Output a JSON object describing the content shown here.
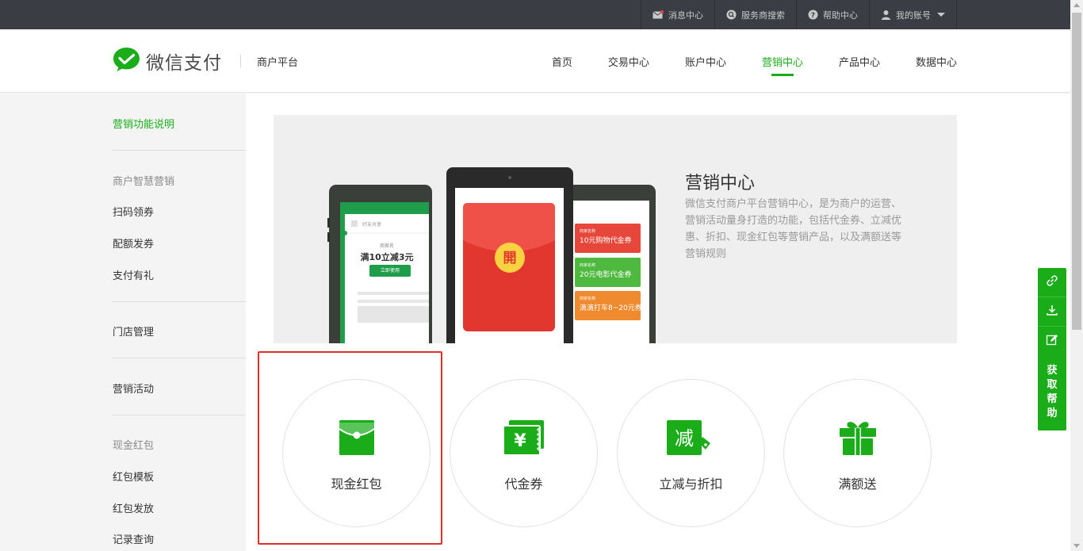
{
  "topbar": {
    "items": [
      {
        "label": "消息中心",
        "icon": "mail-icon"
      },
      {
        "label": "服务商搜索",
        "icon": "search-icon"
      },
      {
        "label": "帮助中心",
        "icon": "question-icon"
      },
      {
        "label": "我的账号",
        "icon": "user-icon"
      }
    ]
  },
  "header": {
    "logo_text": "微信支付",
    "subtitle": "商户平台",
    "nav": [
      {
        "label": "首页"
      },
      {
        "label": "交易中心"
      },
      {
        "label": "账户中心"
      },
      {
        "label": "营销中心",
        "active": true
      },
      {
        "label": "产品中心"
      },
      {
        "label": "数据中心"
      }
    ]
  },
  "sidebar": {
    "intro": "营销功能说明",
    "group_smart": "商户智慧营销",
    "smart_items": [
      "扫码领券",
      "配额发券",
      "支付有礼"
    ],
    "store": "门店管理",
    "activity": "营销活动",
    "group_cash": "现金红包",
    "cash_items": [
      "红包模板",
      "红包发放",
      "记录查询"
    ]
  },
  "banner": {
    "title": "营销中心",
    "description": "微信支付商户平台营销中心，是为商户的运营、营销活动量身打造的功能，包括代金券、立减优惠、折扣、现金红包等营销产品，以及满额送等营销规则",
    "phone_left": {
      "top": "好友共享",
      "merchant": "商家名",
      "offer": "满10立减3元",
      "button": "立即使用"
    },
    "phone_center": {
      "open": "開"
    },
    "phone_right": {
      "coupons": [
        {
          "tag": "商家名称",
          "text": "10元购物代金券"
        },
        {
          "tag": "商家名称",
          "text": "20元电影代金券"
        },
        {
          "tag": "商家名称",
          "text": "滴滴打车8~20元券"
        }
      ]
    }
  },
  "cards": [
    {
      "label": "现金红包",
      "icon": "red-packet-icon"
    },
    {
      "label": "代金券",
      "icon": "voucher-icon"
    },
    {
      "label": "立减与折扣",
      "icon": "discount-icon"
    },
    {
      "label": "满额送",
      "icon": "gift-icon"
    }
  ],
  "float_widget": {
    "help_chars": [
      "获",
      "取",
      "帮",
      "助"
    ]
  },
  "colors": {
    "brand_green": "#1aad19",
    "topbar": "#3a3d44",
    "highlight_red": "#e03128"
  }
}
